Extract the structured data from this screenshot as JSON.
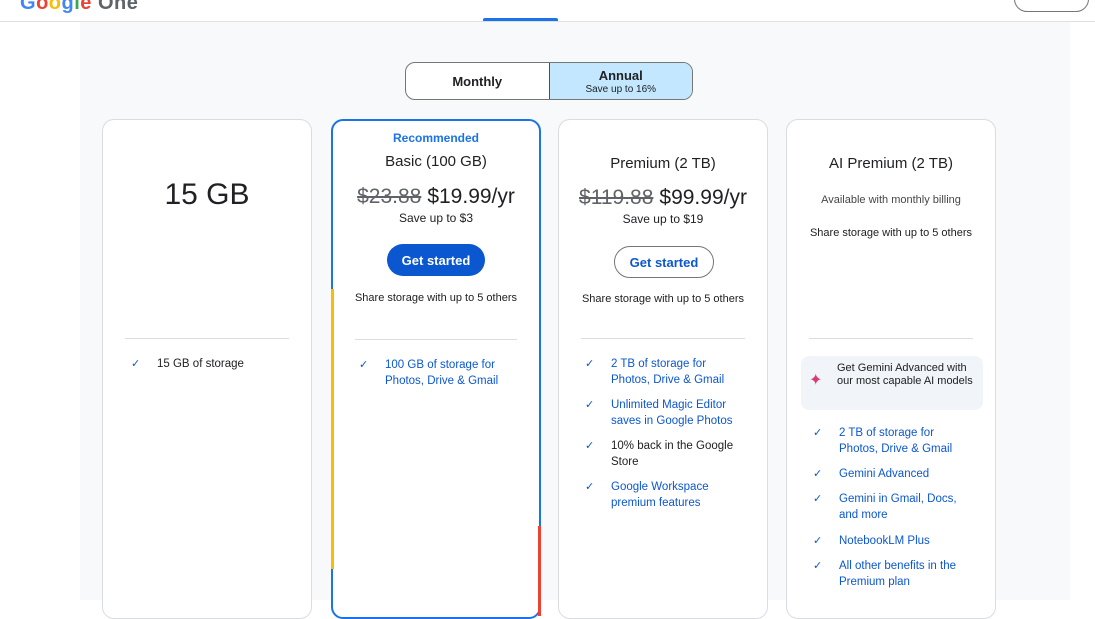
{
  "toggle": {
    "monthly": "Monthly",
    "annual": "Annual",
    "annual_sub": "Save up to 16%"
  },
  "plans": [
    {
      "name": "15 GB",
      "features": [
        "15 GB of storage"
      ]
    },
    {
      "recommended": "Recommended",
      "name": "Basic (100 GB)",
      "old_price": "$23.88",
      "price": "$19.99/yr",
      "save": "Save up to $3",
      "cta": "Get started",
      "share": "Share storage with up to 5 others",
      "features": [
        "100 GB of storage for Photos, Drive & Gmail"
      ]
    },
    {
      "name": "Premium (2 TB)",
      "old_price": "$119.88",
      "price": "$99.99/yr",
      "save": "Save up to $19",
      "cta": "Get started",
      "share": "Share storage with up to 5 others",
      "features": [
        "2 TB of storage for Photos, Drive & Gmail",
        "Unlimited Magic Editor saves in Google Photos",
        "10% back in the Google Store",
        "Google Workspace premium features"
      ]
    },
    {
      "name": "AI Premium (2 TB)",
      "availability": "Available with monthly billing",
      "share": "Share storage with up to 5 others",
      "gemini_callout": "Get Gemini Advanced with our most capable AI models",
      "features": [
        "2 TB of storage for Photos, Drive & Gmail",
        "Gemini Advanced",
        "Gemini in Gmail, Docs, and more",
        "NotebookLM Plus",
        "All other benefits in the Premium plan"
      ]
    }
  ],
  "colors": {
    "accent": "#0b57d0",
    "recommended_border": "#1a73e8",
    "toggle_active": "#c2e7ff"
  }
}
